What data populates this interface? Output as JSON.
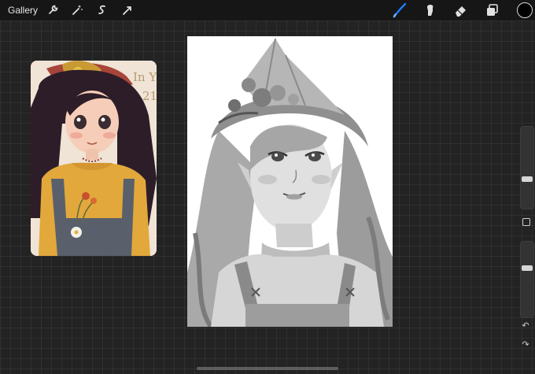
{
  "topbar": {
    "gallery_label": "Gallery",
    "left_tools": [
      "wrench-icon",
      "magic-wand-icon",
      "selection-icon",
      "transform-icon"
    ],
    "right_tools": [
      "brush-icon",
      "smudge-icon",
      "eraser-icon",
      "layers-icon"
    ],
    "active_tool": "brush-icon",
    "accent_color": "#1f7bff",
    "current_color": "#000000"
  },
  "reference": {
    "visible_text": [
      "In Y",
      "21"
    ]
  },
  "sidebar": {
    "brush_size_level": 0.26,
    "opacity_level": 0.34,
    "icons": [
      "undo-icon",
      "redo-icon"
    ]
  },
  "colors": {
    "background": "#232323",
    "topbar": "#161616",
    "canvas": "#ffffff"
  }
}
